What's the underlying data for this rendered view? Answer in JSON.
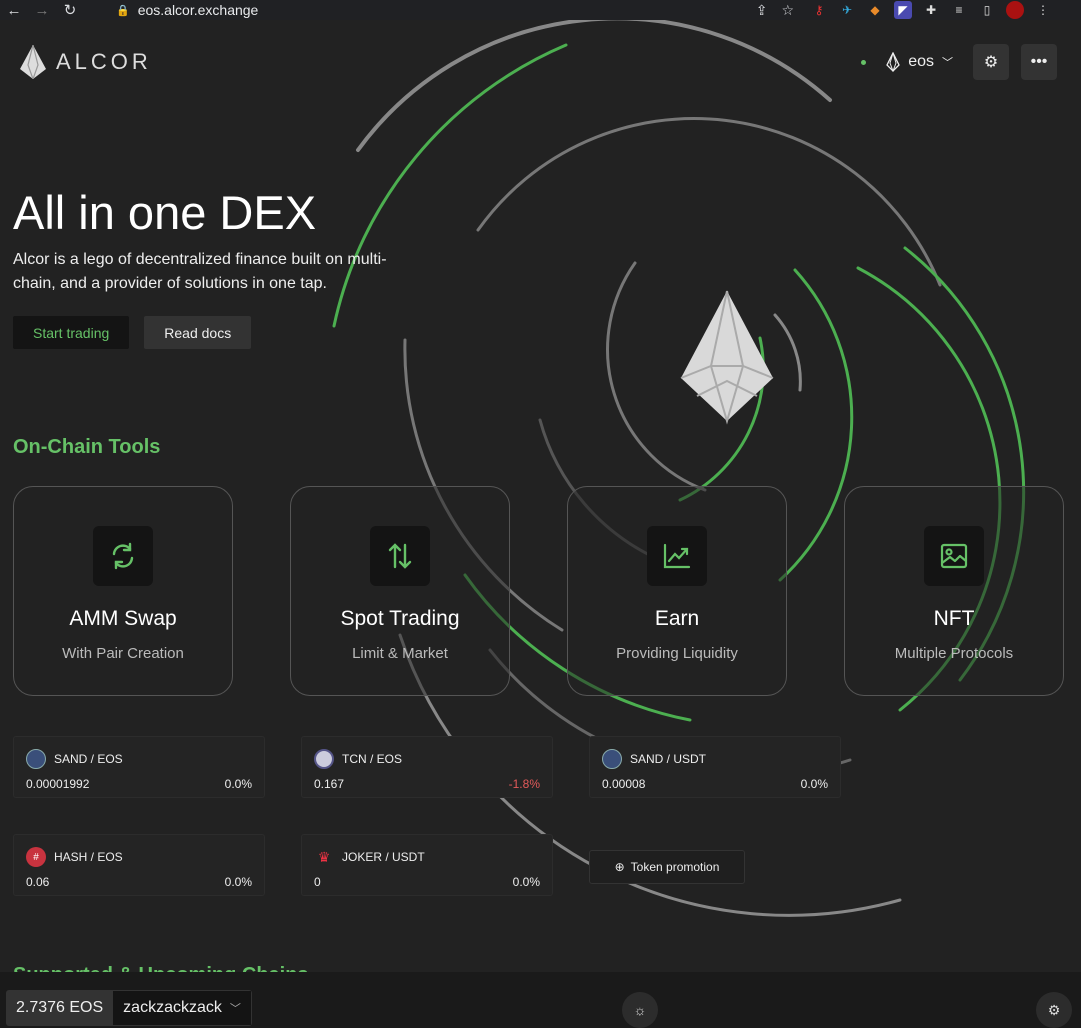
{
  "browser": {
    "back": "←",
    "forward": "→",
    "reload": "↻",
    "url": "eos.alcor.exchange"
  },
  "header": {
    "logo_text": "ALCOR",
    "network": "eos"
  },
  "hero": {
    "title": "All in one DEX",
    "subtitle": "Alcor is a lego of decentralized finance built on multi-chain, and a provider of solutions in one tap.",
    "start_label": "Start trading",
    "docs_label": "Read docs"
  },
  "tools": {
    "title": "On-Chain Tools",
    "items": [
      {
        "name": "AMM Swap",
        "desc": "With Pair Creation",
        "icon": "swap-icon"
      },
      {
        "name": "Spot Trading",
        "desc": "Limit & Market",
        "icon": "arrows-updown-icon"
      },
      {
        "name": "Earn",
        "desc": "Providing Liquidity",
        "icon": "chart-up-icon"
      },
      {
        "name": "NFT",
        "desc": "Multiple Protocols",
        "icon": "image-icon"
      }
    ]
  },
  "pairs": [
    {
      "name": "SAND / EOS",
      "price": "0.00001992",
      "change": "0.0%"
    },
    {
      "name": "TCN / EOS",
      "price": "0.167",
      "change": "-1.8%"
    },
    {
      "name": "SAND / USDT",
      "price": "0.00008",
      "change": "0.0%"
    },
    {
      "name": "HASH / EOS",
      "price": "0.06",
      "change": "0.0%"
    },
    {
      "name": "JOKER / USDT",
      "price": "0",
      "change": "0.0%"
    }
  ],
  "promo_label": "Token promotion",
  "supported_title": "Supported & Upcoming Chains",
  "footer": {
    "balance": "2.7376 EOS",
    "account": "zackzackzack"
  },
  "colors": {
    "accent": "#66c167",
    "negative": "#e25a5a",
    "background": "#222222"
  }
}
